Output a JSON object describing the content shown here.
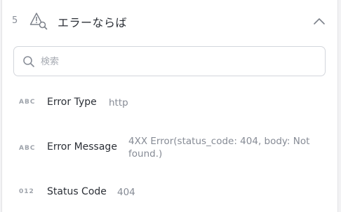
{
  "header": {
    "step_number": "5",
    "title": "エラーならば",
    "icon": "warning-search-icon",
    "collapse_icon": "chevron-up-icon"
  },
  "search": {
    "placeholder": "検索",
    "value": ""
  },
  "fields": [
    {
      "type": "ABC",
      "name": "Error Type",
      "value": "http"
    },
    {
      "type": "ABC",
      "name": "Error Message",
      "value": "4XX Error(status_code: 404, body: Not found.)"
    },
    {
      "type": "012",
      "name": "Status Code",
      "value": "404"
    }
  ],
  "colors": {
    "text_primary": "#2b2f36",
    "text_secondary": "#868b95",
    "border": "#d3d6dc"
  }
}
